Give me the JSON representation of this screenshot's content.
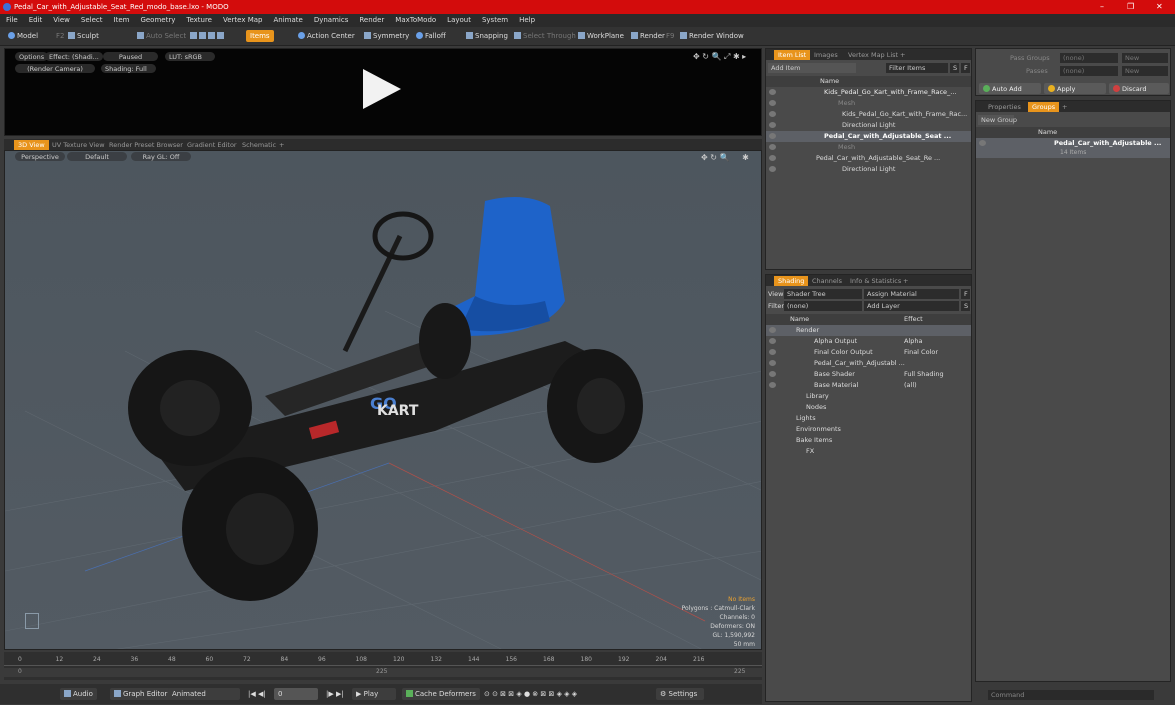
{
  "window": {
    "title": "Pedal_Car_with_Adjustable_Seat_Red_modo_base.lxo - MODO",
    "min": "–",
    "max": "❐",
    "close": "✕"
  },
  "menu": [
    "File",
    "Edit",
    "View",
    "Select",
    "Item",
    "Geometry",
    "Texture",
    "Vertex Map",
    "Animate",
    "Dynamics",
    "Render",
    "MaxToModo",
    "Layout",
    "System",
    "Help"
  ],
  "toolbar": {
    "model": "Model",
    "f2": "F2",
    "sculpt": "Sculpt",
    "auto_select": "Auto Select",
    "items": "Items",
    "action_center": "Action Center",
    "symmetry": "Symmetry",
    "falloff": "Falloff",
    "snapping": "Snapping",
    "select_through": "Select Through",
    "workplane": "WorkPlane",
    "render": "Render",
    "f9": "F9",
    "render_window": "Render Window"
  },
  "preview": {
    "options": "Options",
    "effect": "Effect: (Shadi...",
    "paused": "Paused",
    "lut": "LUT: sRGB",
    "camera": "(Render Camera)",
    "shading": "Shading: Full"
  },
  "view_tabs": [
    "3D View",
    "UV Texture View",
    "Render Preset Browser",
    "Gradient Editor",
    "Schematic",
    "+"
  ],
  "viewport": {
    "perspective": "Perspective",
    "default": "Default",
    "raygl": "Ray GL: Off",
    "no_items": "No Items",
    "polygons": "Polygons : Catmull-Clark",
    "channels": "Channels: 0",
    "deformers": "Deformers: ON",
    "gl": "GL: 1,590,992",
    "scale": "50 mm",
    "logo_go": "GO",
    "logo_kart": "KART"
  },
  "timeline": {
    "ticks": [
      "0",
      "12",
      "24",
      "36",
      "48",
      "60",
      "72",
      "84",
      "96",
      "108",
      "120",
      "132",
      "144",
      "156",
      "168",
      "180",
      "192",
      "204",
      "216"
    ],
    "start": "0",
    "mid": "225",
    "end": "225"
  },
  "bottom": {
    "audio": "Audio",
    "graph_editor": "Graph Editor",
    "animated": "Animated",
    "frame": "0",
    "play": "Play",
    "cache": "Cache Deformers",
    "settings": "Settings"
  },
  "item_list": {
    "tabs": [
      "Item List",
      "Images",
      "Vertex Map List",
      "+"
    ],
    "add_item": "Add Item",
    "filter": "Filter Items",
    "s": "S",
    "f": "F",
    "col_name": "Name",
    "rows": [
      "Kids_Pedal_Go_Kart_with_Frame_Race_...",
      "Mesh",
      "Kids_Pedal_Go_Kart_with_Frame_Rac...",
      "Directional Light",
      "Pedal_Car_with_Adjustable_Seat ...",
      "Mesh",
      "Pedal_Car_with_Adjustable_Seat_Re ...",
      "Directional Light"
    ]
  },
  "shading": {
    "tabs": [
      "Shading",
      "Channels",
      "Info & Statistics",
      "+"
    ],
    "view_label": "View",
    "view_value": "Shader Tree",
    "assign": "Assign Material",
    "f": "F",
    "filter_label": "Filter",
    "filter_value": "(none)",
    "add_layer": "Add Layer",
    "s": "S",
    "col_name": "Name",
    "col_effect": "Effect",
    "rows": [
      {
        "n": "Render",
        "e": ""
      },
      {
        "n": "Alpha Output",
        "e": "Alpha"
      },
      {
        "n": "Final Color Output",
        "e": "Final Color"
      },
      {
        "n": "Pedal_Car_with_Adjustabl ...",
        "e": ""
      },
      {
        "n": "Base Shader",
        "e": "Full Shading"
      },
      {
        "n": "Base Material",
        "e": "(all)"
      },
      {
        "n": "Library",
        "e": ""
      },
      {
        "n": "Nodes",
        "e": ""
      },
      {
        "n": "Lights",
        "e": ""
      },
      {
        "n": "Environments",
        "e": ""
      },
      {
        "n": "Bake Items",
        "e": ""
      },
      {
        "n": "FX",
        "e": ""
      }
    ]
  },
  "right": {
    "pass_groups": "Pass Groups",
    "passes": "Passes",
    "none": "(none)",
    "new": "New",
    "auto_add": "Auto Add",
    "apply": "Apply",
    "discard": "Discard",
    "tabs": [
      "Properties",
      "Groups",
      "+"
    ],
    "new_group": "New Group",
    "col_name": "Name",
    "group_name": "Pedal_Car_with_Adjustable ...",
    "group_items": "14 Items",
    "command": "Command"
  },
  "colors": {
    "accent": "#e8941c",
    "title": "#d30c0c",
    "seat": "#1e63c9"
  }
}
